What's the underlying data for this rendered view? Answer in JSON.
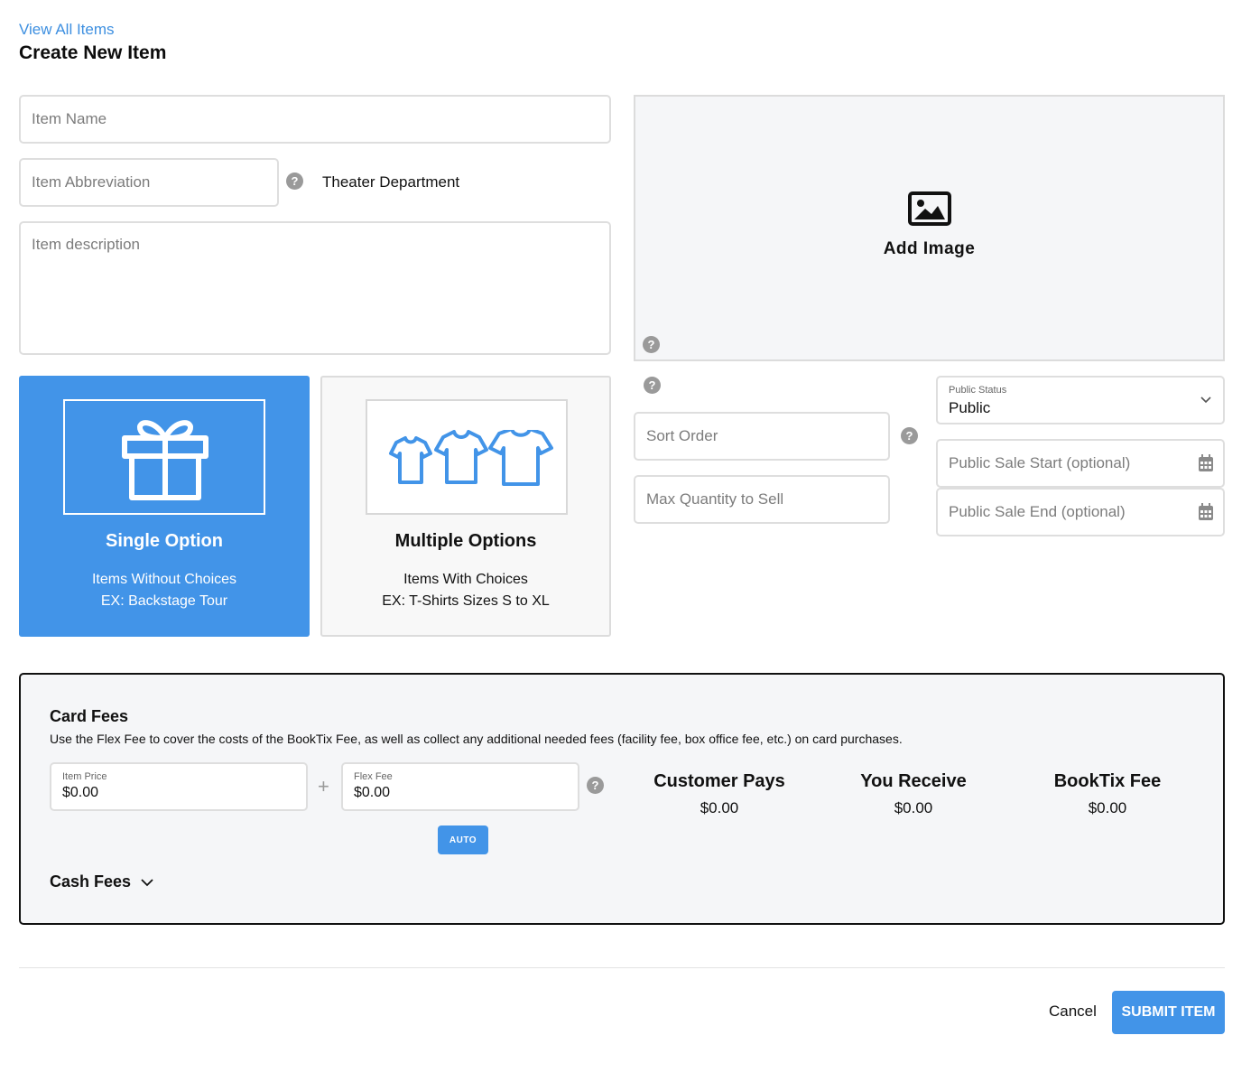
{
  "header": {
    "back_link": "View All Items",
    "title": "Create New Item"
  },
  "form": {
    "item_name_placeholder": "Item Name",
    "item_abbreviation_placeholder": "Item Abbreviation",
    "department": "Theater Department",
    "description_placeholder": "Item description",
    "sort_order_placeholder": "Sort Order",
    "max_quantity_placeholder": "Max Quantity to Sell",
    "public_status": {
      "label": "Public Status",
      "value": "Public"
    },
    "public_sale_start_placeholder": "Public Sale Start (optional)",
    "public_sale_end_placeholder": "Public Sale End (optional)"
  },
  "image": {
    "label": "Add Image"
  },
  "options": {
    "selected": "single",
    "single": {
      "title": "Single Option",
      "line1": "Items Without Choices",
      "line2": "EX: Backstage Tour"
    },
    "multiple": {
      "title": "Multiple Options",
      "line1": "Items With Choices",
      "line2": "EX: T-Shirts Sizes S to XL"
    }
  },
  "fees": {
    "title": "Card Fees",
    "description": "Use the Flex Fee to cover the costs of the BookTix Fee, as well as collect any additional needed fees (facility fee, box office fee, etc.) on card purchases.",
    "item_price": {
      "label": "Item Price",
      "value": "$0.00"
    },
    "plus": "+",
    "flex_fee": {
      "label": "Flex Fee",
      "value": "$0.00"
    },
    "auto_label": "AUTO",
    "customer_pays": {
      "label": "Customer Pays",
      "value": "$0.00"
    },
    "you_receive": {
      "label": "You Receive",
      "value": "$0.00"
    },
    "booktix_fee": {
      "label": "BookTix Fee",
      "value": "$0.00"
    },
    "cash_fees_label": "Cash Fees"
  },
  "footer": {
    "cancel_label": "Cancel",
    "submit_label": "SUBMIT ITEM"
  },
  "colors": {
    "accent": "#4294e8",
    "link": "#3d8fe0",
    "border": "#dedede",
    "panel_bg": "#f5f6f8"
  },
  "icons": {
    "help": "question-circle-icon",
    "image": "image-icon",
    "gift": "gift-icon",
    "shirt": "t-shirt-icon",
    "chevron": "chevron-down-icon",
    "calendar": "calendar-icon"
  }
}
